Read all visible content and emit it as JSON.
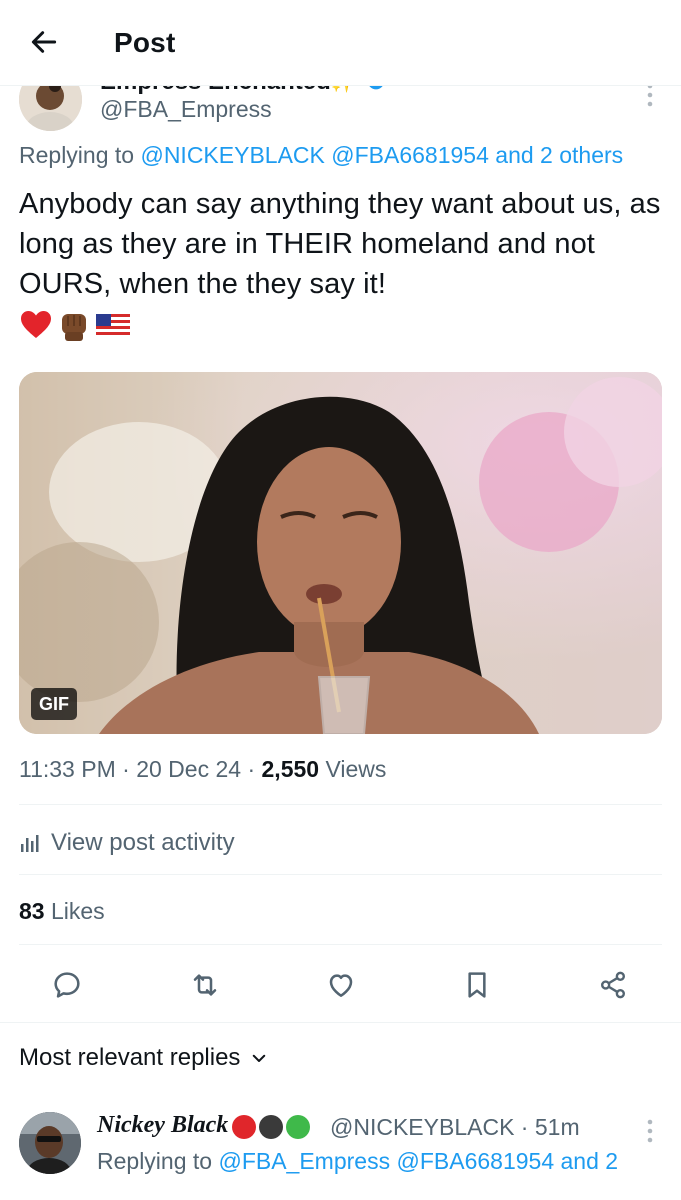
{
  "header": {
    "title": "Post",
    "back_icon": "arrow-left-icon"
  },
  "author": {
    "name": "Empress Enchanted",
    "name_emoji": "✨",
    "verified_color": "#1d9bf0",
    "handle": "@FBA_Empress"
  },
  "reply_to": {
    "prefix": "Replying to",
    "mention_1": "@NICKEYBLACK",
    "mention_2": "@FBA6681954",
    "suffix": "and 2 others"
  },
  "tweet": {
    "text": "Anybody can say anything they want about us, as long as they are in THEIR homeland and not OURS, when the they say it!",
    "emojis": [
      "red-heart-icon",
      "raised-fist-icon",
      "us-flag-icon"
    ]
  },
  "media": {
    "badge": "GIF",
    "description_icon": "gif-image"
  },
  "meta": {
    "time": "11:33 PM",
    "date": "20 Dec 24",
    "views_count": "2,550",
    "views_label": "Views",
    "sep": "·"
  },
  "activity": {
    "label": "View post activity",
    "icon": "bar-chart-icon"
  },
  "likes": {
    "count": "83",
    "label": "Likes"
  },
  "actions": {
    "reply_icon": "comment-icon",
    "repost_icon": "repost-icon",
    "like_icon": "heart-icon",
    "bookmark_icon": "bookmark-icon",
    "share_icon": "share-icon"
  },
  "replies_section": {
    "label": "Most relevant replies",
    "icon": "chevron-down-icon"
  },
  "reply": {
    "name": "Nickey Black",
    "dots": [
      "#e0262b",
      "#3a3a3a",
      "#3fb94a"
    ],
    "handle": "@NICKEYBLACK",
    "time": "51m",
    "sep": "·",
    "replying_prefix": "Replying to",
    "mention_1": "@FBA_Empress",
    "mention_2": "@FBA6681954",
    "suffix": "and 2"
  },
  "colors": {
    "accent": "#1d9bf0",
    "text": "#0f1419",
    "muted": "#536471",
    "divider": "#eff3f4"
  }
}
